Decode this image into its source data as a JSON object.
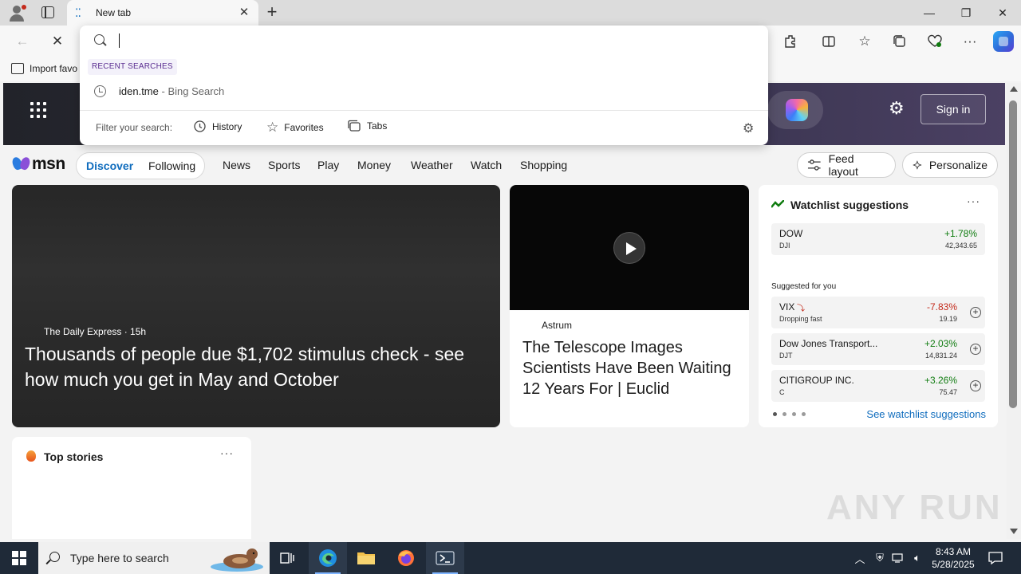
{
  "tab": {
    "title": "New tab",
    "close": "✕",
    "new": "+"
  },
  "window": {
    "minimize": "—",
    "restore": "❐",
    "close": "✕"
  },
  "favorites_bar": {
    "import_label": "Import favo"
  },
  "omnibox": {
    "value": "",
    "recent_label": "RECENT SEARCHES",
    "recent": [
      {
        "query": "iden.tme",
        "engine": "Bing Search",
        "separator": " - "
      }
    ],
    "filter_label": "Filter your search:",
    "filters": [
      {
        "label": "History",
        "icon": "history-icon"
      },
      {
        "label": "Favorites",
        "icon": "star-icon"
      },
      {
        "label": "Tabs",
        "icon": "tabs-icon"
      }
    ]
  },
  "msn": {
    "logo": "msn",
    "sign_in": "Sign in",
    "feed_tabs": [
      "Discover",
      "Following"
    ],
    "nav": [
      "News",
      "Sports",
      "Play",
      "Money",
      "Weather",
      "Watch",
      "Shopping"
    ],
    "feed_layout": "Feed layout",
    "personalize": "Personalize"
  },
  "cards": {
    "main": {
      "source": "The Daily Express · 15h",
      "headline": "Thousands of people due $1,702 stimulus check - see how much you get in May and October"
    },
    "video": {
      "source": "Astrum",
      "headline": "The Telescope Images Scientists Have Been Waiting 12 Years For | Euclid"
    },
    "top_stories": {
      "title": "Top stories",
      "more": "···"
    }
  },
  "watchlist": {
    "title": "Watchlist suggestions",
    "more": "···",
    "dow": {
      "name": "DOW",
      "symbol": "DJI",
      "change": "+1.78%",
      "value": "42,343.65"
    },
    "suggested_label": "Suggested for you",
    "suggested": [
      {
        "name": "VIX",
        "symbol": "Dropping fast",
        "change": "-7.83%",
        "value": "19.19"
      },
      {
        "name": "Dow Jones Transport...",
        "symbol": "DJT",
        "change": "+2.03%",
        "value": "14,831.24"
      },
      {
        "name": "CITIGROUP INC.",
        "symbol": "C",
        "change": "+3.26%",
        "value": "75.47"
      }
    ],
    "see_all": "See watchlist suggestions"
  },
  "watermark": "ANY RUN",
  "taskbar": {
    "search_placeholder": "Type here to search",
    "time": "8:43 AM",
    "date": "5/28/2025"
  },
  "colors": {
    "accent": "#0f6cbd",
    "up": "#107c10",
    "down": "#c42b1c",
    "taskbar": "#1f2a38"
  }
}
